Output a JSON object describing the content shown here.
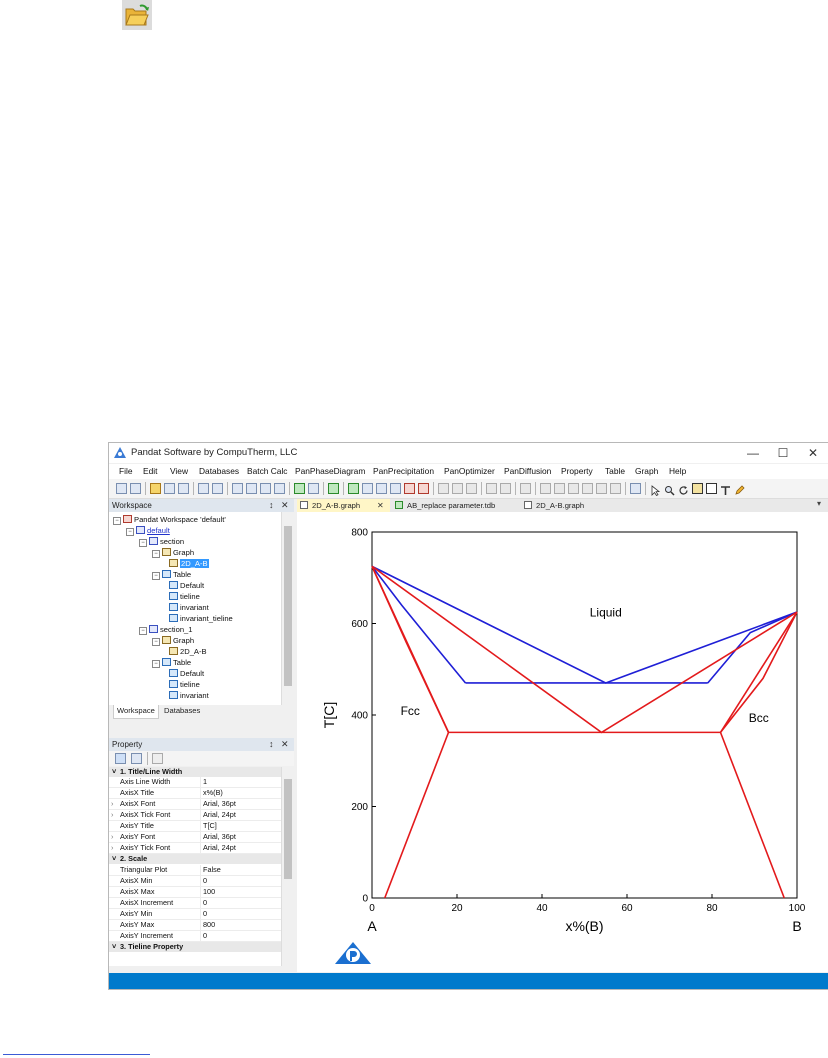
{
  "window": {
    "title": "Pandat Software by CompuTherm, LLC",
    "controls": [
      "—",
      "☐",
      "✕"
    ]
  },
  "menu": [
    "File",
    "Edit",
    "View",
    "Databases",
    "Batch Calc",
    "PanPhaseDiagram",
    "PanPrecipitation",
    "PanOptimizer",
    "PanDiffusion",
    "Property",
    "Table",
    "Graph",
    "Help"
  ],
  "workspace": {
    "title": "Workspace",
    "pin": "↕",
    "close": "✕",
    "tree": {
      "root": "Pandat Workspace 'default'",
      "default": "default",
      "section": "section",
      "graph": "Graph",
      "graph_item": "2D_A-B",
      "table": "Table",
      "t_default": "Default",
      "t_tieline": "tieline",
      "t_invariant": "invariant",
      "t_invariant_tieline": "invariant_tieline",
      "section_1": "section_1",
      "graph2": "Graph",
      "graph_item2": "2D_A-B",
      "table2": "Table",
      "t2_default": "Default",
      "t2_tieline": "tieline",
      "t2_invariant": "invariant"
    },
    "tabs": [
      "Workspace",
      "Databases"
    ]
  },
  "property": {
    "title": "Property",
    "pin": "↕",
    "close": "✕",
    "cat1": "1. Title/Line Width",
    "cat2": "2. Scale",
    "cat3": "3. Tieline Property",
    "rows1": [
      {
        "k": "Axis Line Width",
        "v": "1"
      },
      {
        "k": "AxisX Title",
        "v": "x%(B)"
      },
      {
        "k": "AxisX Font",
        "v": "Arial, 36pt"
      },
      {
        "k": "AxisX Tick Font",
        "v": "Arial, 24pt"
      },
      {
        "k": "AxisY Title",
        "v": "T[C]"
      },
      {
        "k": "AxisY Font",
        "v": "Arial, 36pt"
      },
      {
        "k": "AxisY Tick Font",
        "v": "Arial, 24pt"
      }
    ],
    "rows2": [
      {
        "k": "Triangular Plot",
        "v": "False"
      },
      {
        "k": "AxisX Min",
        "v": "0"
      },
      {
        "k": "AxisX Max",
        "v": "100"
      },
      {
        "k": "AxisX Increment",
        "v": "0"
      },
      {
        "k": "AxisY Min",
        "v": "0"
      },
      {
        "k": "AxisY Max",
        "v": "800"
      },
      {
        "k": "AxisY Increment",
        "v": "0"
      }
    ]
  },
  "doc_tabs": [
    "2D_A-B.graph",
    "AB_replace parameter.tdb",
    "2D_A-B.graph"
  ],
  "doc_tab_close": "✕",
  "chart_data": {
    "type": "line",
    "xlabel": "x%(B)",
    "ylabel": "T[C]",
    "xlim": [
      0,
      100
    ],
    "ylim": [
      0,
      800
    ],
    "xticks": [
      "0",
      "20",
      "40",
      "60",
      "80",
      "100"
    ],
    "yticks": [
      "0",
      "200",
      "400",
      "600",
      "800"
    ],
    "grid": false,
    "end_labels": {
      "left": "A",
      "right": "B"
    },
    "phase_labels": [
      {
        "text": "Liquid",
        "x": 55,
        "y": 615
      },
      {
        "text": "Fcc",
        "x": 9,
        "y": 400
      },
      {
        "text": "Bcc",
        "x": 91,
        "y": 385
      }
    ],
    "series": [
      {
        "color": "#1f1fd6",
        "points": [
          [
            0,
            725
          ],
          [
            55,
            470
          ],
          [
            100,
            625
          ]
        ]
      },
      {
        "color": "#1f1fd6",
        "points": [
          [
            0,
            725
          ],
          [
            7,
            640
          ],
          [
            14,
            560
          ],
          [
            22,
            470
          ]
        ]
      },
      {
        "color": "#1f1fd6",
        "points": [
          [
            22,
            470
          ],
          [
            79,
            470
          ]
        ]
      },
      {
        "color": "#1f1fd6",
        "points": [
          [
            79,
            470
          ],
          [
            89,
            580
          ],
          [
            100,
            625
          ]
        ]
      },
      {
        "color": "#e31a1c",
        "points": [
          [
            0,
            725
          ],
          [
            54,
            362
          ],
          [
            100,
            625
          ]
        ]
      },
      {
        "color": "#e31a1c",
        "points": [
          [
            0,
            725
          ],
          [
            8,
            560
          ],
          [
            18,
            362
          ]
        ]
      },
      {
        "color": "#e31a1c",
        "points": [
          [
            18,
            362
          ],
          [
            82,
            362
          ]
        ]
      },
      {
        "color": "#e31a1c",
        "points": [
          [
            82,
            362
          ],
          [
            92,
            480
          ],
          [
            100,
            625
          ]
        ]
      },
      {
        "color": "#e31a1c",
        "points": [
          [
            3,
            0
          ],
          [
            18,
            362
          ]
        ]
      },
      {
        "color": "#e31a1c",
        "points": [
          [
            82,
            362
          ],
          [
            97,
            0
          ]
        ]
      },
      {
        "color": "#e31a1c",
        "points": [
          [
            0,
            725
          ],
          [
            18,
            362
          ]
        ]
      },
      {
        "color": "#e31a1c",
        "points": [
          [
            82,
            362
          ],
          [
            100,
            625
          ]
        ]
      }
    ]
  }
}
